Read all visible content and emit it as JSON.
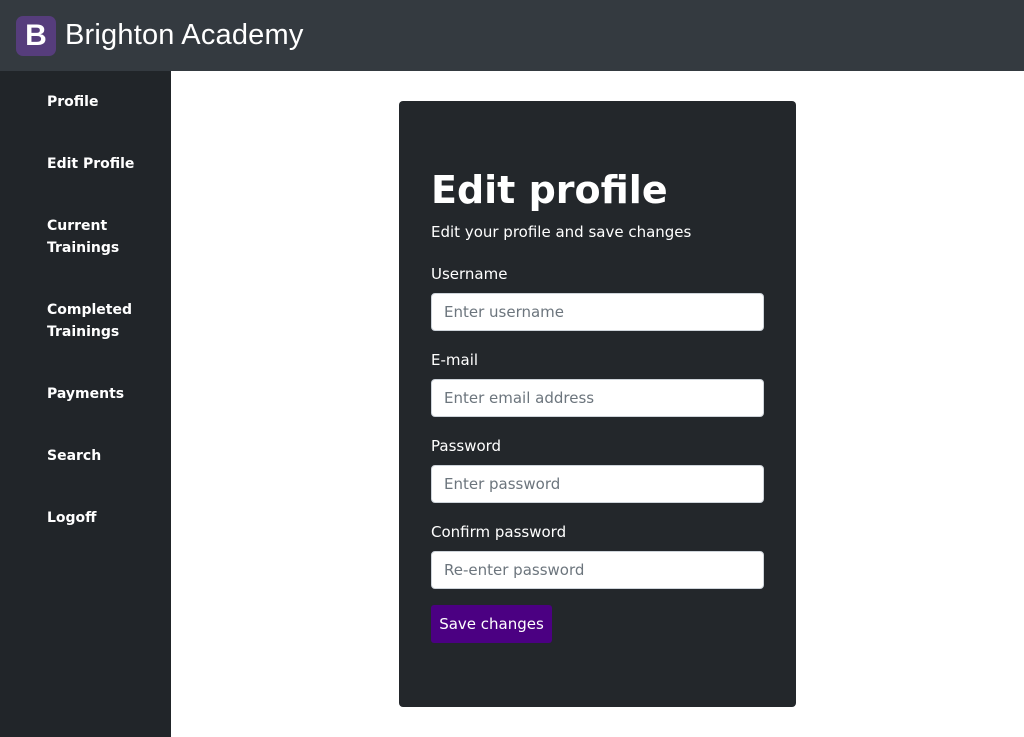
{
  "header": {
    "logo_letter": "B",
    "brand": "Brighton Academy"
  },
  "sidebar": {
    "items": [
      {
        "label": "Profile"
      },
      {
        "label": "Edit Profile"
      },
      {
        "label": "Current Trainings"
      },
      {
        "label": "Completed Trainings"
      },
      {
        "label": "Payments"
      },
      {
        "label": "Search"
      },
      {
        "label": "Logoff"
      }
    ]
  },
  "form": {
    "title": "Edit profile",
    "subtitle": "Edit your profile and save changes",
    "username": {
      "label": "Username",
      "placeholder": "Enter username",
      "value": ""
    },
    "email": {
      "label": "E-mail",
      "placeholder": "Enter email address",
      "value": ""
    },
    "password": {
      "label": "Password",
      "placeholder": "Enter password",
      "value": ""
    },
    "confirm": {
      "label": "Confirm password",
      "placeholder": "Re-enter password",
      "value": ""
    },
    "save_label": "Save changes"
  },
  "colors": {
    "topbar": "#343a40",
    "sidebar": "#212529",
    "card": "#23272b",
    "brand_logo": "#563d7c",
    "save_button": "#4b0082"
  }
}
